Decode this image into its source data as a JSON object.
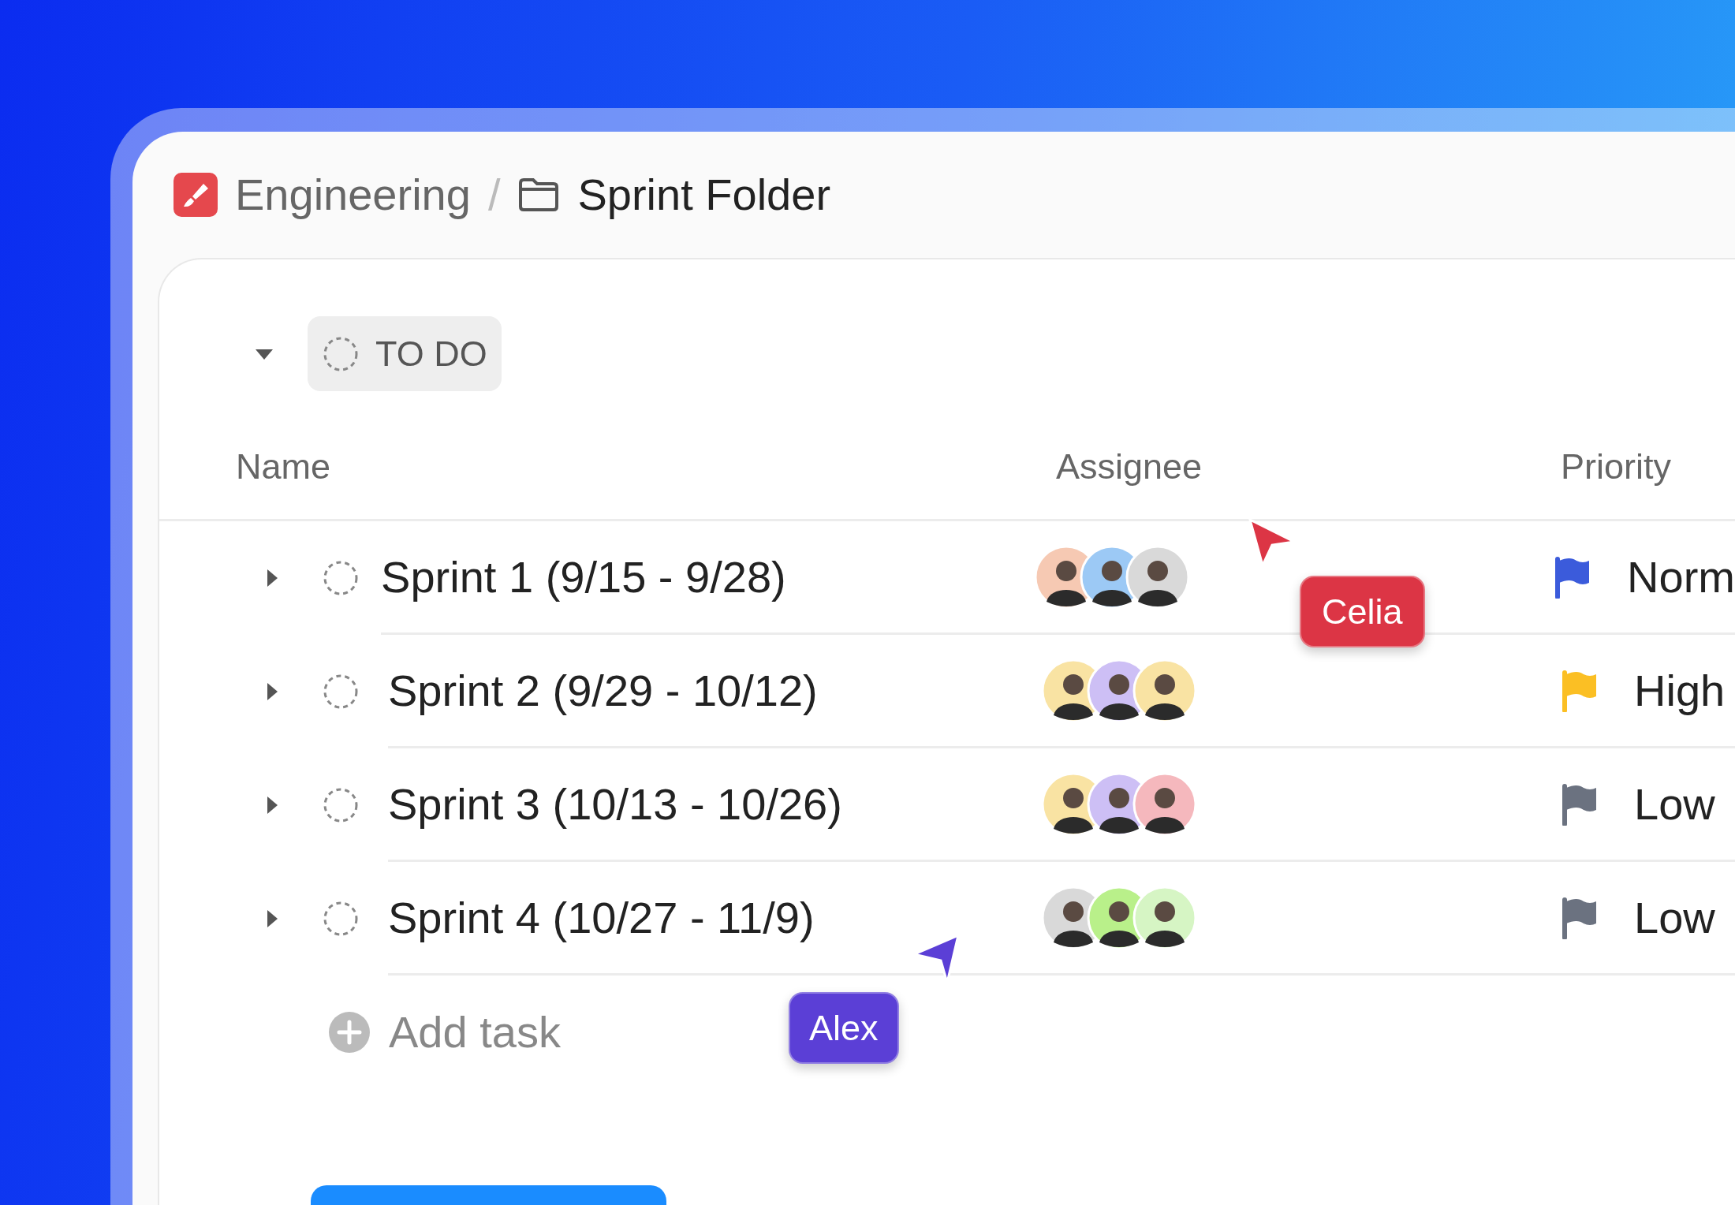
{
  "breadcrumb": {
    "space": "Engineering",
    "separator": "/",
    "folder": "Sprint Folder"
  },
  "group": {
    "label": "TO DO",
    "expanded": true
  },
  "columns": [
    "Name",
    "Assignee",
    "Priority"
  ],
  "rows": [
    {
      "name": "Sprint 1 (9/15 - 9/28)",
      "expanded": false,
      "avatars": [
        {
          "color": "#f6c9b3"
        },
        {
          "color": "#9cc9f5"
        },
        {
          "color": "#d9d9d9"
        }
      ],
      "priority": {
        "label": "Norm",
        "color": "#3b5bdb"
      }
    },
    {
      "name": "Sprint 2 (9/29 - 10/12)",
      "expanded": false,
      "avatars": [
        {
          "color": "#f9e3a3"
        },
        {
          "color": "#cdbff5"
        },
        {
          "color": "#f9e3a3"
        }
      ],
      "priority": {
        "label": "High",
        "color": "#fbbf24"
      }
    },
    {
      "name": "Sprint 3 (10/13 - 10/26)",
      "expanded": false,
      "avatars": [
        {
          "color": "#f9e3a3"
        },
        {
          "color": "#cdbff5"
        },
        {
          "color": "#f5b8bd"
        }
      ],
      "priority": {
        "label": "Low",
        "color": "#6b7280"
      }
    },
    {
      "name": "Sprint 4 (10/27 - 11/9)",
      "expanded": false,
      "avatars": [
        {
          "color": "#d9d9d9"
        },
        {
          "color": "#b9f08a"
        },
        {
          "color": "#d6f5c4"
        }
      ],
      "priority": {
        "label": "Low",
        "color": "#6b7280"
      }
    }
  ],
  "add_task": "Add task",
  "cursors": [
    {
      "name": "Celia",
      "color": "#dc3545"
    },
    {
      "name": "Alex",
      "color": "#5b3fd6"
    }
  ]
}
